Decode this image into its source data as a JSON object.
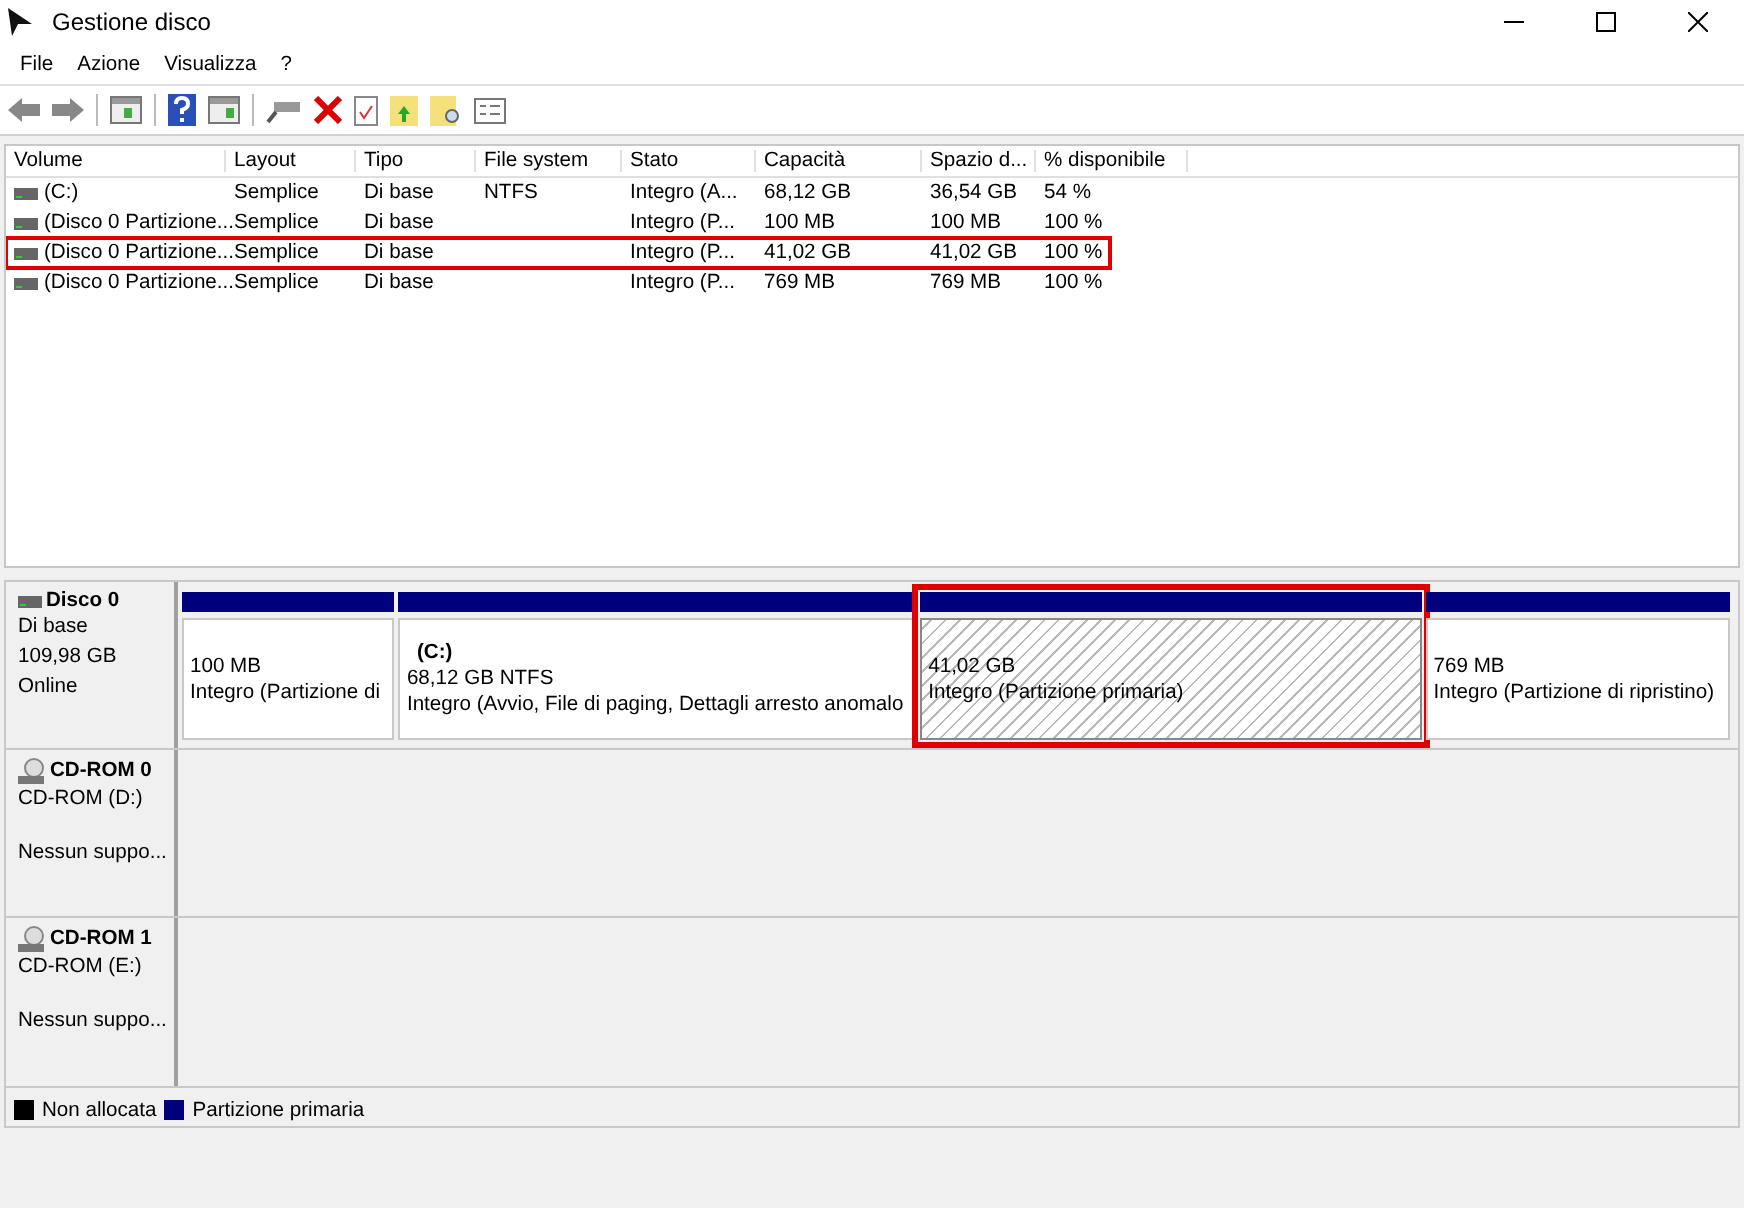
{
  "window": {
    "title": "Gestione disco"
  },
  "menu": [
    "File",
    "Azione",
    "Visualizza",
    "?"
  ],
  "table": {
    "columns": [
      "Volume",
      "Layout",
      "Tipo",
      "File system",
      "Stato",
      "Capacità",
      "Spazio d...",
      "% disponibile"
    ],
    "rows": [
      {
        "selected": false,
        "cells": [
          "(C:)",
          "Semplice",
          "Di base",
          "NTFS",
          "Integro (A...",
          "68,12 GB",
          "36,54 GB",
          "54 %"
        ]
      },
      {
        "selected": false,
        "cells": [
          "(Disco 0 Partizione...",
          "Semplice",
          "Di base",
          "",
          "Integro (P...",
          "100 MB",
          "100 MB",
          "100 %"
        ]
      },
      {
        "selected": true,
        "cells": [
          "(Disco 0 Partizione...",
          "Semplice",
          "Di base",
          "",
          "Integro (P...",
          "41,02 GB",
          "41,02 GB",
          "100 %"
        ]
      },
      {
        "selected": false,
        "cells": [
          "(Disco 0 Partizione...",
          "Semplice",
          "Di base",
          "",
          "Integro (P...",
          "769 MB",
          "769 MB",
          "100 %"
        ]
      }
    ]
  },
  "disks": [
    {
      "kind": "disk",
      "name": "Disco 0",
      "lines": [
        "Di base",
        "109,98 GB",
        "Online"
      ],
      "partitions": [
        {
          "selected": false,
          "size": "100 MB",
          "status": "Integro (Partizione di"
        },
        {
          "selected": false,
          "name": "(C:)",
          "size": "68,12 GB NTFS",
          "status": "Integro (Avvio, File di paging, Dettagli arresto anomalo"
        },
        {
          "selected": true,
          "size": "41,02 GB",
          "status": "Integro (Partizione primaria)"
        },
        {
          "selected": false,
          "size": "769 MB",
          "status": "Integro (Partizione di ripristino)"
        }
      ]
    },
    {
      "kind": "cdrom",
      "name": "CD-ROM 0",
      "lines": [
        "CD-ROM (D:)",
        "Nessun suppo..."
      ]
    },
    {
      "kind": "cdrom",
      "name": "CD-ROM 1",
      "lines": [
        "CD-ROM (E:)",
        "Nessun suppo..."
      ]
    }
  ],
  "legend": [
    {
      "label": "Non allocata",
      "color": "#000000"
    },
    {
      "label": "Partizione primaria",
      "color": "#00007f"
    }
  ]
}
